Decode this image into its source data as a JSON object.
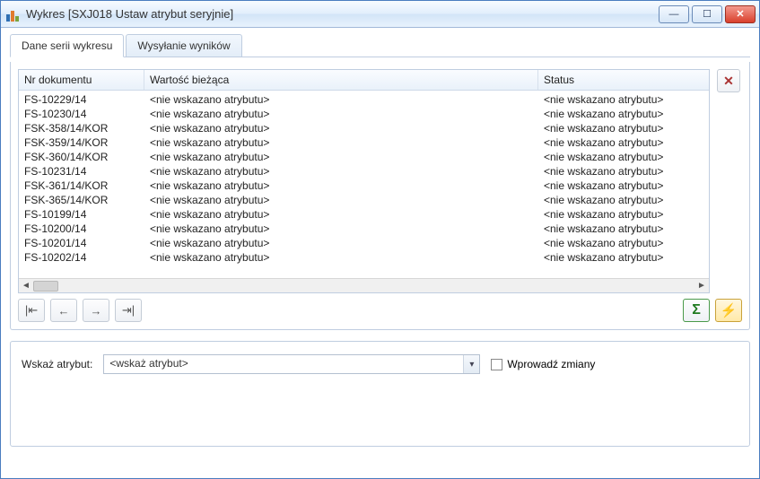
{
  "window": {
    "title": "Wykres [SXJ018 Ustaw atrybut seryjnie]"
  },
  "tabs": [
    {
      "label": "Dane serii wykresu",
      "active": true
    },
    {
      "label": "Wysyłanie wyników",
      "active": false
    }
  ],
  "grid": {
    "columns": {
      "doc": "Nr dokumentu",
      "val": "Wartość bieżąca",
      "status": "Status"
    },
    "rows": [
      {
        "doc": "FS-10229/14",
        "val": "<nie wskazano atrybutu>",
        "status": "<nie wskazano atrybutu>"
      },
      {
        "doc": "FS-10230/14",
        "val": "<nie wskazano atrybutu>",
        "status": "<nie wskazano atrybutu>"
      },
      {
        "doc": "FSK-358/14/KOR",
        "val": "<nie wskazano atrybutu>",
        "status": "<nie wskazano atrybutu>"
      },
      {
        "doc": "FSK-359/14/KOR",
        "val": "<nie wskazano atrybutu>",
        "status": "<nie wskazano atrybutu>"
      },
      {
        "doc": "FSK-360/14/KOR",
        "val": "<nie wskazano atrybutu>",
        "status": "<nie wskazano atrybutu>"
      },
      {
        "doc": "FS-10231/14",
        "val": "<nie wskazano atrybutu>",
        "status": "<nie wskazano atrybutu>"
      },
      {
        "doc": "FSK-361/14/KOR",
        "val": "<nie wskazano atrybutu>",
        "status": "<nie wskazano atrybutu>"
      },
      {
        "doc": "FSK-365/14/KOR",
        "val": "<nie wskazano atrybutu>",
        "status": "<nie wskazano atrybutu>"
      },
      {
        "doc": "FS-10199/14",
        "val": "<nie wskazano atrybutu>",
        "status": "<nie wskazano atrybutu>"
      },
      {
        "doc": "FS-10200/14",
        "val": "<nie wskazano atrybutu>",
        "status": "<nie wskazano atrybutu>"
      },
      {
        "doc": "FS-10201/14",
        "val": "<nie wskazano atrybutu>",
        "status": "<nie wskazano atrybutu>"
      },
      {
        "doc": "FS-10202/14",
        "val": "<nie wskazano atrybutu>",
        "status": "<nie wskazano atrybutu>"
      }
    ]
  },
  "bottom": {
    "label": "Wskaż atrybut:",
    "combo_value": "<wskaż atrybut>",
    "checkbox_label": "Wprowadź zmiany"
  },
  "icons": {
    "delete": "✕",
    "first": "|⇤",
    "prev": "←",
    "next": "→",
    "last": "⇥|",
    "sigma": "Σ",
    "bolt": "⚡",
    "combo_arrow": "▾",
    "scroll_left": "◄",
    "scroll_right": "►",
    "min": "—",
    "max": "☐",
    "close": "✕"
  }
}
